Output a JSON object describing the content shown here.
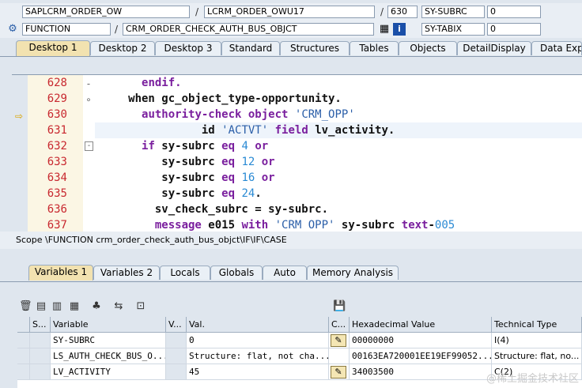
{
  "header": {
    "program": "SAPLCRM_ORDER_OW",
    "include": "LCRM_ORDER_OWU17",
    "line": "630",
    "sy_subrc_label": "SY-SUBRC",
    "sy_subrc_value": "0",
    "event_type": "FUNCTION",
    "event_name": "CRM_ORDER_CHECK_AUTH_BUS_OBJCT",
    "sy_tabix_label": "SY-TABIX",
    "sy_tabix_value": "0"
  },
  "desktop_tabs": [
    "Desktop 1",
    "Desktop 2",
    "Desktop 3",
    "Standard",
    "Structures",
    "Tables",
    "Objects",
    "DetailDisplay",
    "Data Expl"
  ],
  "code": {
    "line_numbers": [
      "628",
      "629",
      "630",
      "631",
      "632",
      "633",
      "634",
      "635",
      "636",
      "637"
    ],
    "current_line": "630"
  },
  "scope": "Scope \\FUNCTION crm_order_check_auth_bus_objct\\IF\\IF\\CASE",
  "variable_tabs": [
    "Variables 1",
    "Variables 2",
    "Locals",
    "Globals",
    "Auto",
    "Memory Analysis"
  ],
  "table": {
    "headers": [
      "S...",
      "Variable",
      "V...",
      "Val.",
      "C...",
      "Hexadecimal Value",
      "Technical Type"
    ],
    "rows": [
      {
        "variable": "SY-SUBRC",
        "value": "0",
        "hex": "00000000",
        "type": "I(4)"
      },
      {
        "variable": "LS_AUTH_CHECK_BUS_O...",
        "value": "Structure: flat, not cha...",
        "hex": "00163EA720001EE19EF99052...",
        "type": "Structure: flat, no..."
      },
      {
        "variable": "LV_ACTIVITY",
        "value": "45",
        "hex": "34003500",
        "type": "C(2)"
      }
    ]
  },
  "watermark": "@稀土掘金技术社区"
}
